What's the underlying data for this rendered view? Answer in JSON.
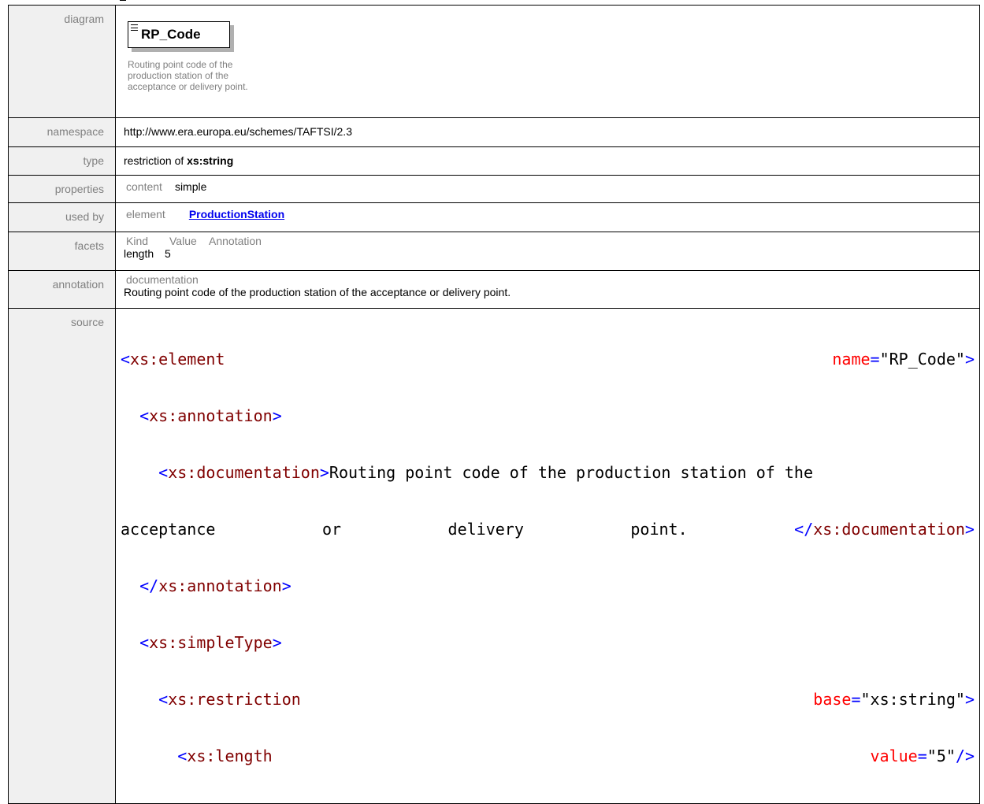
{
  "labels": {
    "diagram": "diagram",
    "namespace": "namespace",
    "type": "type",
    "properties": "properties",
    "used_by": "used by",
    "facets": "facets",
    "annotation": "annotation",
    "source": "source"
  },
  "diagram": {
    "element_name": "RP_Code",
    "doc": "Routing point code of the production station of the acceptance or delivery point."
  },
  "namespace": "http://www.era.europa.eu/schemes/TAFTSI/2.3",
  "type": {
    "prefix": "restriction of ",
    "base": "xs:string"
  },
  "properties": {
    "key": "content",
    "value": "simple"
  },
  "used_by": {
    "kind": "element",
    "link": "ProductionStation"
  },
  "facets": {
    "headers": [
      "Kind",
      "Value",
      "Annotation"
    ],
    "rows": [
      {
        "kind": "length",
        "value": "5",
        "annotation": ""
      }
    ]
  },
  "annotation": {
    "header": "documentation",
    "text": "Routing point code of the production station of the acceptance or delivery point."
  },
  "source": {
    "l1_open": "<",
    "l1_tag": "xs:element",
    "l1_attr": "name",
    "l1_eq": "=",
    "l1_val": "\"RP_Code\"",
    "l1_close": ">",
    "l2": "xs:annotation",
    "l3_tag": "xs:documentation",
    "l3_text": "Routing point code of the production station of the",
    "l4_w1": "acceptance",
    "l4_w2": "or",
    "l4_w3": "delivery",
    "l4_w4": "point.",
    "l4_end": "xs:documentation",
    "l5": "xs:annotation",
    "l6": "xs:simpleType",
    "l7_tag": "xs:restriction",
    "l7_attr": "base",
    "l7_val": "\"xs:string\"",
    "l8_tag": "xs:length",
    "l8_attr": "value",
    "l8_val": "\"5\"",
    "l8_close": "/>"
  }
}
